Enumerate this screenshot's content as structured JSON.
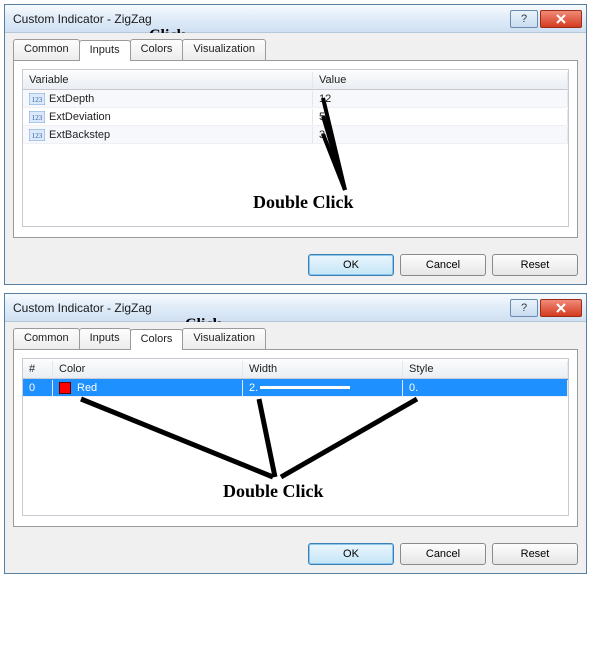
{
  "dialog1": {
    "title": "Custom Indicator - ZigZag",
    "tabs": {
      "common": "Common",
      "inputs": "Inputs",
      "colors": "Colors",
      "visualization": "Visualization"
    },
    "active_tab": "inputs",
    "columns": {
      "variable": "Variable",
      "value": "Value"
    },
    "rows": [
      {
        "name": "ExtDepth",
        "value": "12"
      },
      {
        "name": "ExtDeviation",
        "value": "5"
      },
      {
        "name": "ExtBackstep",
        "value": "3"
      }
    ],
    "buttons": {
      "ok": "OK",
      "cancel": "Cancel",
      "reset": "Reset"
    },
    "annotations": {
      "click": "Click",
      "double_click": "Double Click"
    }
  },
  "dialog2": {
    "title": "Custom Indicator - ZigZag",
    "tabs": {
      "common": "Common",
      "inputs": "Inputs",
      "colors": "Colors",
      "visualization": "Visualization"
    },
    "active_tab": "colors",
    "columns": {
      "index": "#",
      "color": "Color",
      "width": "Width",
      "style": "Style"
    },
    "rows": [
      {
        "index": "0",
        "color_name": "Red",
        "color_hex": "#ff0000",
        "width": "2.",
        "style": "0."
      }
    ],
    "buttons": {
      "ok": "OK",
      "cancel": "Cancel",
      "reset": "Reset"
    },
    "annotations": {
      "click": "Click",
      "double_click": "Double Click"
    }
  }
}
